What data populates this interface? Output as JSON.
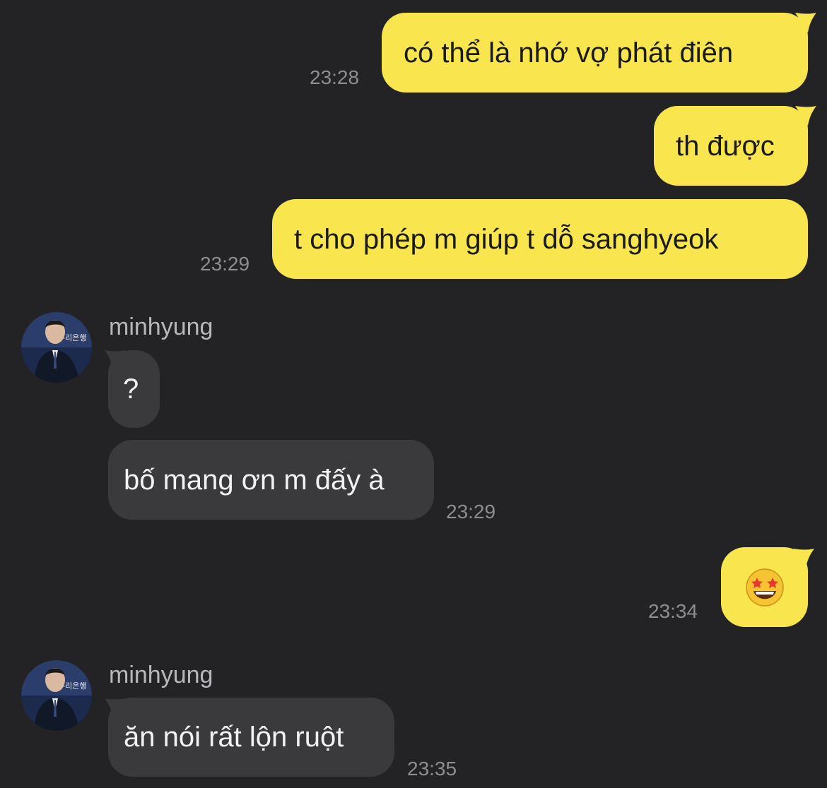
{
  "conversation": {
    "messages": [
      {
        "direction": "outgoing",
        "text": "có thể là nhớ vợ phát điên",
        "time": "23:28"
      },
      {
        "direction": "outgoing",
        "text": "th được",
        "time": ""
      },
      {
        "direction": "outgoing",
        "text": "t cho phép m giúp t dỗ sanghyeok",
        "time": "23:29"
      },
      {
        "direction": "incoming",
        "sender": "minhyung",
        "text": "?",
        "time": ""
      },
      {
        "direction": "incoming",
        "text": "bố mang ơn m đấy à",
        "time": "23:29"
      },
      {
        "direction": "outgoing",
        "emoji": "star-struck-emoji",
        "time": "23:34"
      },
      {
        "direction": "incoming",
        "sender": "minhyung",
        "text": "ăn nói rất lộn ruột",
        "time": "23:35"
      }
    ]
  },
  "avatar_sign_text": "우리은행",
  "colors": {
    "background": "#232325",
    "outgoing_bubble": "#f9e54e",
    "incoming_bubble": "#3a3a3c",
    "timestamp": "#8e8e92",
    "sender_name": "#b8b8bc"
  }
}
